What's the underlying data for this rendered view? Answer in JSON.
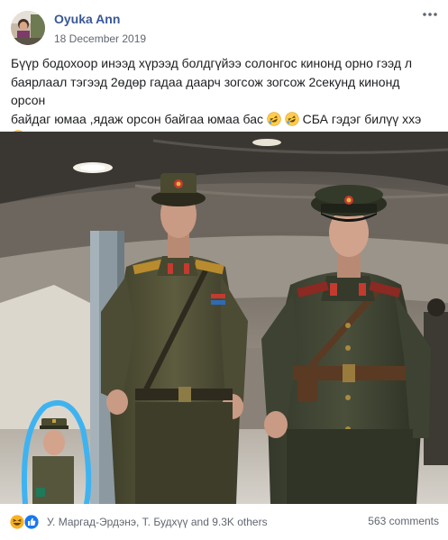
{
  "post": {
    "author": "Oyuka Ann",
    "date": "18 December 2019",
    "text_line1": "Бүүр бодохоор инээд хүрээд болдгүйээ солонгос кинонд орно гээд л",
    "text_line2": "баярлаал тэгээд 2өдөр гадаа даарч зогсож зогсож 2секунд кинонд орсон",
    "text_line3a": "байдаг юмаа ,ядаж орсон байгаа юмаа бас",
    "text_line3b": " СБА гэдэг билүү ххэ",
    "emojis": [
      "rolling-on-floor-laughing",
      "rolling-on-floor-laughing",
      "winking-face-with-tongue"
    ]
  },
  "photo": {
    "alt_icons": [
      "soldier-left",
      "soldier-right",
      "circled-bystander"
    ],
    "highlight_color": "#3fb3f0"
  },
  "footer": {
    "reaction_icons": [
      "haha-icon",
      "like-icon"
    ],
    "reactors": "У. Маргад-Эрдэнэ, Т. Будхүү and 9.3K others",
    "comments": "563 comments"
  },
  "colors": {
    "name": "#385898",
    "meta": "#616770",
    "like_blue": "#1877f2",
    "haha_yellow": "#f7b125"
  }
}
